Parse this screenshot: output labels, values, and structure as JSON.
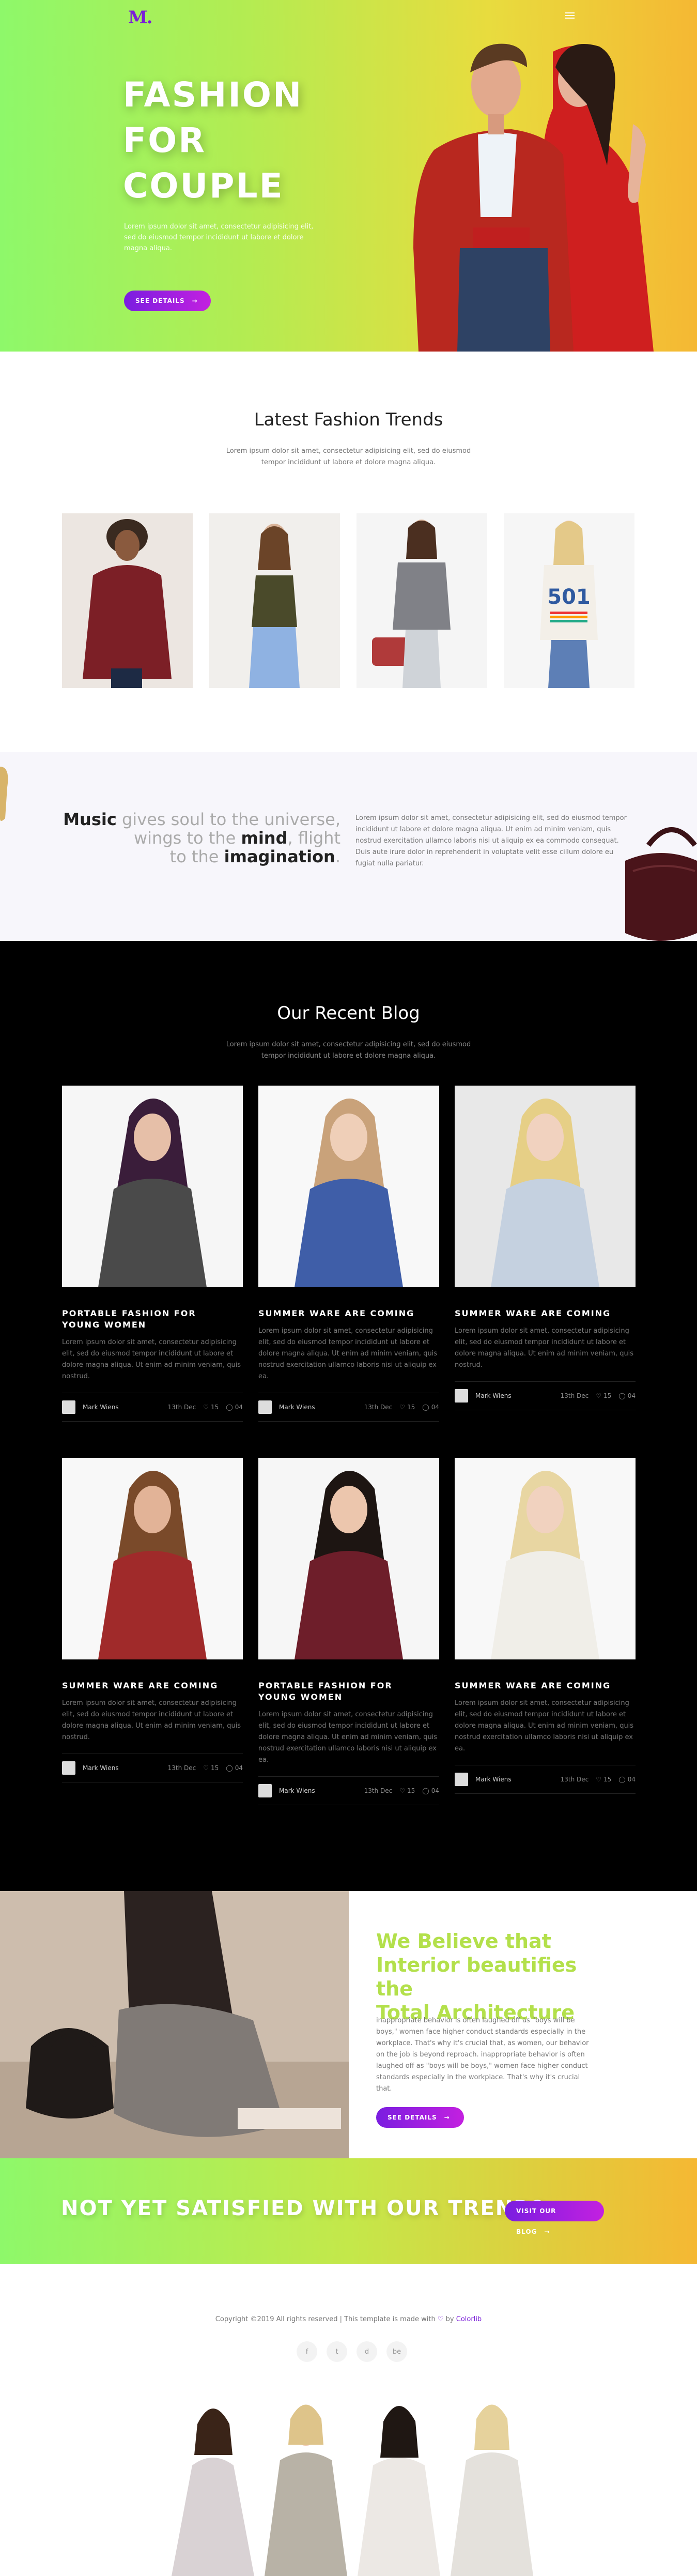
{
  "header": {
    "logo": "M.",
    "menu_icon": "hamburger-icon"
  },
  "hero": {
    "title": "FASHION\nFOR\nCOUPLE",
    "text": "Lorem ipsum dolor sit amet, consectetur adipisicing elit, sed do eiusmod tempor incididunt ut labore et dolore magna aliqua.",
    "button": "SEE DETAILS",
    "button_arrow": "→"
  },
  "trends": {
    "title": "Latest Fashion Trends",
    "subtitle": "Lorem ipsum dolor sit amet, consectetur adipisicing elit, sed do eiusmod\ntempor incididunt ut labore et dolore magna aliqua."
  },
  "music": {
    "w1": "Music",
    "w2": " gives soul to the universe,",
    "w3": "wings to the ",
    "w4": "mind",
    "w5": ", flight",
    "w6": "to the ",
    "w7": "imagination",
    "w8": ".",
    "text": "Lorem ipsum dolor sit amet, consectetur adipisicing elit, sed do eiusmod tempor incididunt ut labore et dolore magna aliqua. Ut enim ad minim veniam, quis nostrud exercitation ullamco laboris nisi ut aliquip ex ea commodo consequat. Duis aute irure dolor in reprehenderit in voluptate velit esse cillum dolore eu fugiat nulla pariatur."
  },
  "blog": {
    "title": "Our Recent Blog",
    "subtitle": "Lorem ipsum dolor sit amet, consectetur adipisicing elit, sed do eiusmod\ntempor incididunt ut labore et dolore magna aliqua.",
    "posts": [
      {
        "title": "PORTABLE FASHION FOR\nYOUNG WOMEN",
        "text": "Lorem ipsum dolor sit amet, consectetur adipisicing elit, sed do eiusmod tempor incididunt ut labore et dolore magna aliqua. Ut enim ad minim veniam, quis nostrud.",
        "author": "Mark Wiens",
        "date": "13th Dec",
        "likes": "15",
        "comments": "04"
      },
      {
        "title": "SUMMER WARE ARE COMING",
        "text": "Lorem ipsum dolor sit amet, consectetur adipisicing elit, sed do eiusmod tempor incididunt ut labore et dolore magna aliqua. Ut enim ad minim veniam, quis nostrud exercitation ullamco laboris nisi ut aliquip ex ea.",
        "author": "Mark Wiens",
        "date": "13th Dec",
        "likes": "15",
        "comments": "04"
      },
      {
        "title": "SUMMER WARE ARE COMING",
        "text": "Lorem ipsum dolor sit amet, consectetur adipisicing elit, sed do eiusmod tempor incididunt ut labore et dolore magna aliqua. Ut enim ad minim veniam, quis nostrud.",
        "author": "Mark Wiens",
        "date": "13th Dec",
        "likes": "15",
        "comments": "04"
      },
      {
        "title": "SUMMER WARE ARE COMING",
        "text": "Lorem ipsum dolor sit amet, consectetur adipisicing elit, sed do eiusmod tempor incididunt ut labore et dolore magna aliqua. Ut enim ad minim veniam, quis nostrud.",
        "author": "Mark Wiens",
        "date": "13th Dec",
        "likes": "15",
        "comments": "04"
      },
      {
        "title": "PORTABLE FASHION FOR\nYOUNG WOMEN",
        "text": "Lorem ipsum dolor sit amet, consectetur adipisicing elit, sed do eiusmod tempor incididunt ut labore et dolore magna aliqua. Ut enim ad minim veniam, quis nostrud exercitation ullamco laboris nisi ut aliquip ex ea.",
        "author": "Mark Wiens",
        "date": "13th Dec",
        "likes": "15",
        "comments": "04"
      },
      {
        "title": "SUMMER WARE ARE COMING",
        "text": "Lorem ipsum dolor sit amet, consectetur adipisicing elit, sed do eiusmod tempor incididunt ut labore et dolore magna aliqua. Ut enim ad minim veniam, quis nostrud exercitation ullamco laboris nisi ut aliquip ex ea.",
        "author": "Mark Wiens",
        "date": "13th Dec",
        "likes": "15",
        "comments": "04"
      }
    ]
  },
  "believe": {
    "title": "We Believe that\nInterior beautifies the\nTotal Architecture",
    "text": "inappropriate behavior is often laughed off as \"boys will be boys,\" women face higher conduct standards especially in the workplace. That's why it's crucial that, as women, our behavior on the job is beyond reproach. inappropriate behavior is often laughed off as \"boys will be boys,\" women face higher conduct standards especially in the workplace. That's why it's crucial that.",
    "button": "SEE DETAILS",
    "button_arrow": "→"
  },
  "cta": {
    "title": "NOT YET SATISFIED WITH OUR TREND?",
    "button": "VISIT OUR BLOG",
    "button_arrow": "→"
  },
  "footer": {
    "copy_pre": "Copyright ©2019 All rights reserved | This template is made with ",
    "heart": "♡",
    "by": " by ",
    "link": "Colorlib",
    "socials": [
      "f",
      "t",
      "d",
      "be"
    ]
  },
  "colors": {
    "accent": "#7a1dd8",
    "green": "#8ef86a",
    "orange": "#f5b833",
    "believe": "#b3e04b"
  }
}
